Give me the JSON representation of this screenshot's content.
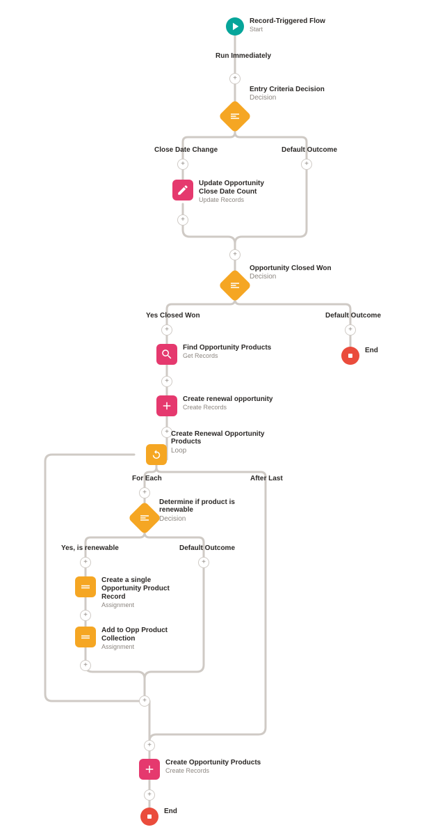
{
  "start": {
    "title": "Record-Triggered Flow",
    "subtitle": "Start"
  },
  "runImmediately": "Run Immediately",
  "entryDecision": {
    "title": "Entry Criteria Decision",
    "subtitle": "Decision"
  },
  "branchA": "Close Date Change",
  "branchB": "Default Outcome",
  "updateCount": {
    "title": "Update Opportunity Close Date Count",
    "subtitle": "Update Records"
  },
  "closedWonDecision": {
    "title": "Opportunity Closed Won",
    "subtitle": "Decision"
  },
  "branchYes": "Yes Closed Won",
  "branchDefault2": "Default Outcome",
  "endLabel": "End",
  "findProducts": {
    "title": "Find Opportunity Products",
    "subtitle": "Get Records"
  },
  "createRenewal": {
    "title": "Create renewal opportunity",
    "subtitle": "Create Records"
  },
  "loopTitle": {
    "title": "Create Renewal Opportunity Products",
    "subtitle": "Loop"
  },
  "forEach": "For Each",
  "afterLast": "After Last",
  "determine": {
    "title": "Determine if product is renewable",
    "subtitle": "Decision"
  },
  "branchYesRenew": "Yes, is renewable",
  "branchDefault3": "Default Outcome",
  "createSingle": {
    "title": "Create a single Opportunity Product Record",
    "subtitle": "Assignment"
  },
  "addToColl": {
    "title": "Add to Opp Product Collection",
    "subtitle": "Assignment"
  },
  "createOppProducts": {
    "title": "Create Opportunity Products",
    "subtitle": "Create Records"
  }
}
